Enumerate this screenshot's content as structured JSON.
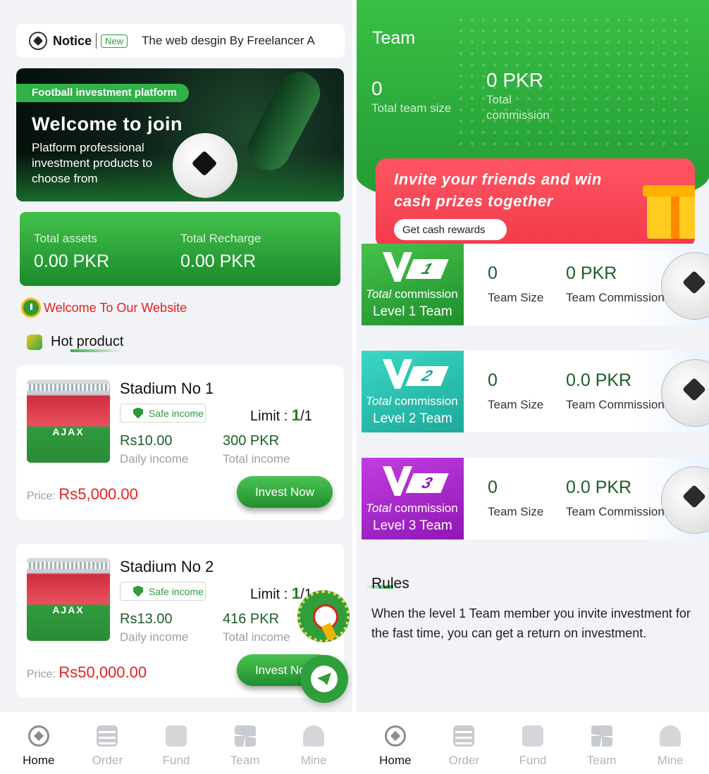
{
  "left": {
    "notice": {
      "title": "Notice",
      "badge": "New",
      "text": "The web desgin By Freelancer A"
    },
    "banner": {
      "tag": "Football investment platform",
      "heading": "Welcome to join",
      "subtext": "Platform professional investment products to choose from"
    },
    "assets": {
      "total_assets_label": "Total assets",
      "total_assets_value": "0.00 PKR",
      "total_recharge_label": "Total Recharge",
      "total_recharge_value": "0.00 PKR"
    },
    "welcome_text": "Welcome To Our Website",
    "hot_product_title": "Hot product",
    "products": [
      {
        "name": "Stadium No 1",
        "image_text": "AJAX",
        "safe_label": "Safe income",
        "limit_label": "Limit : ",
        "limit_used": "1",
        "limit_total": "/1",
        "daily_income": "Rs10.00",
        "daily_income_label": "Daily income",
        "total_income": "300 PKR",
        "total_income_label": "Total income",
        "price_label": "Price: ",
        "price": "Rs5,000.00",
        "button": "Invest Now"
      },
      {
        "name": "Stadium No 2",
        "image_text": "AJAX",
        "safe_label": "Safe income",
        "limit_label": "Limit : ",
        "limit_used": "1",
        "limit_total": "/1",
        "daily_income": "Rs13.00",
        "daily_income_label": "Daily income",
        "total_income": "416 PKR",
        "total_income_label": "Total income",
        "price_label": "Price: ",
        "price": "Rs50,000.00",
        "button": "Invest Now"
      }
    ]
  },
  "right": {
    "title": "Team",
    "team_size_value": "0",
    "team_size_label": "Total team size",
    "commission_value": "0 PKR",
    "commission_label_1": "Total",
    "commission_label_2": "commission",
    "invite": {
      "line1": "Invite your friends and win",
      "line2": "cash prizes together",
      "button": "Get cash rewards"
    },
    "levels": [
      {
        "badge": "1",
        "commission_prefix": "Total",
        "commission_suffix": " commission",
        "name": "Level 1 Team",
        "size": "0",
        "size_label": "Team Size",
        "amount": "0 PKR",
        "amount_label": "Team Commission",
        "color": "#2aa83a"
      },
      {
        "badge": "2",
        "commission_prefix": "Total",
        "commission_suffix": " commission",
        "name": "Level 2 Team",
        "size": "0",
        "size_label": "Team Size",
        "amount": "0.0 PKR",
        "amount_label": "Team Commission",
        "color": "#1fb7a7"
      },
      {
        "badge": "3",
        "commission_prefix": "Total",
        "commission_suffix": " commission",
        "name": "Level 3 Team",
        "size": "0",
        "size_label": "Team Size",
        "amount": "0.0 PKR",
        "amount_label": "Team Commission",
        "color": "#a521c9"
      }
    ],
    "rules_title": "Rules",
    "rules_text": "When the level 1 Team member you invite investment for the fast time, you can get a return on investment."
  },
  "tabbar": {
    "items": [
      {
        "label": "Home",
        "icon": "football-icon",
        "active": true
      },
      {
        "label": "Order",
        "icon": "order-list-icon",
        "active": false
      },
      {
        "label": "Fund",
        "icon": "chart-icon",
        "active": false
      },
      {
        "label": "Team",
        "icon": "grid-icon",
        "active": false
      },
      {
        "label": "Mine",
        "icon": "user-icon",
        "active": false
      }
    ]
  },
  "colors": {
    "brand_green": "#2aa83a",
    "price_red": "#e32020",
    "invite_red": "#f23a4a"
  }
}
